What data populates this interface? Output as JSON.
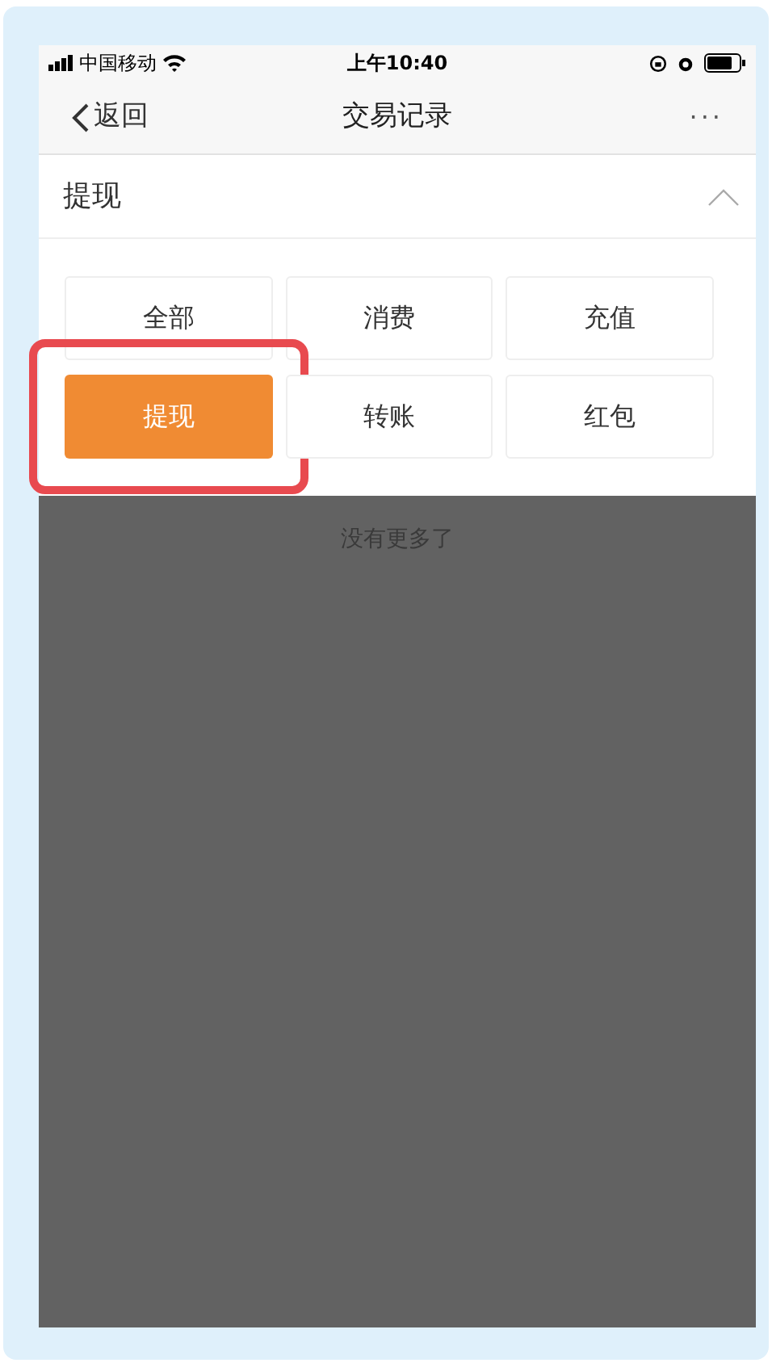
{
  "status_bar": {
    "carrier": "中国移动",
    "time": "上午10:40"
  },
  "nav": {
    "back": "返回",
    "title": "交易记录",
    "more": "···"
  },
  "section": {
    "title": "提现",
    "expanded": true
  },
  "filters": [
    {
      "label": "全部",
      "selected": false,
      "highlighted": false
    },
    {
      "label": "消费",
      "selected": false,
      "highlighted": false
    },
    {
      "label": "充值",
      "selected": false,
      "highlighted": false
    },
    {
      "label": "提现",
      "selected": true,
      "highlighted": true
    },
    {
      "label": "转账",
      "selected": false,
      "highlighted": false
    },
    {
      "label": "红包",
      "selected": false,
      "highlighted": false
    }
  ],
  "empty_message": "没有更多了"
}
